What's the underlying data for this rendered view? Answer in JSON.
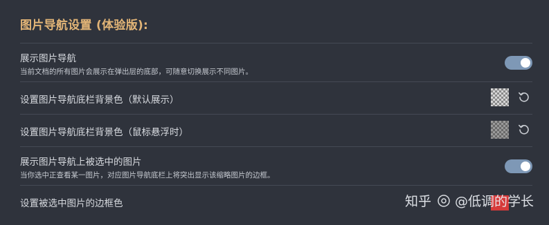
{
  "header": {
    "title": "图片导航设置 (体验版):"
  },
  "settings": [
    {
      "label": "展示图片导航",
      "description": "当前文档的所有图片会展示在弹出层的底部，可随意切换展示不同图片。",
      "control": "toggle",
      "value": true
    },
    {
      "label": "设置图片导航底栏背景色（默认展示）",
      "control": "color-swatch",
      "value": "transparent",
      "reset_icon": "reset-icon"
    },
    {
      "label": "设置图片导航底栏背景色（鼠标悬浮时）",
      "control": "color-swatch",
      "value": "transparent",
      "reset_icon": "reset-icon"
    },
    {
      "label": "展示图片导航上被选中的图片",
      "description": "当你选中正查看某一图片，对应图片导航底栏上将突出显示该缩略图片的边框。",
      "control": "toggle",
      "value": true
    },
    {
      "label": "设置被选中图片的边框色",
      "control": "color-swatch",
      "value": "#d63a3a"
    }
  ],
  "watermark": {
    "text_left": "知乎",
    "text_right": "@低调的学长"
  },
  "colors": {
    "background": "#2f333c",
    "title": "#e3b577",
    "toggle_on": "#7e98b6",
    "divider": "#454a55"
  }
}
